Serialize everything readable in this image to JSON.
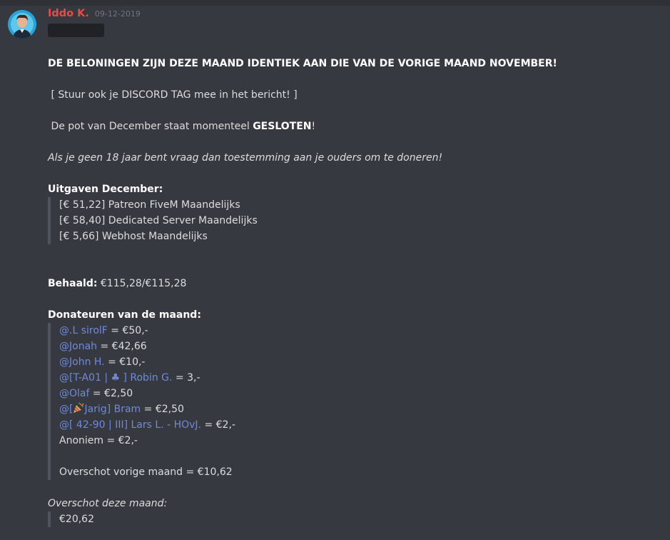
{
  "message": {
    "author": "Iddo K.",
    "timestamp": "09-12-2019",
    "headline": "DE BELONINGEN ZIJN DEZE MAAND IDENTIEK AAN DIE VAN DE VORIGE MAAND NOVEMBER!",
    "discord_tag_note": "[ Stuur ook je DISCORD TAG mee in het bericht! ]",
    "pot_prefix": "De pot van December staat momenteel ",
    "pot_status": "GESLOTEN",
    "pot_suffix": "!",
    "age_note": "Als je geen 18 jaar bent vraag dan toestemming aan je ouders om te doneren!",
    "expenses_title": "Uitgaven December:",
    "expenses": [
      "[€ 51,22] Patreon FiveM Maandelijks",
      "[€ 58,40] Dedicated Server Maandelijks",
      "[€ 5,66] Webhost Maandelijks"
    ],
    "achieved_label": "Behaald:",
    "achieved_value": " €115,28/€115,28",
    "donors_title": "Donateuren van de maand:",
    "donors": [
      {
        "mention": "@.L sirolF",
        "amount": " = €50,-"
      },
      {
        "mention": "@Jonah",
        "amount": " = €42,66"
      },
      {
        "mention": "@John H.",
        "amount": " = €10,-"
      },
      {
        "mention": "@[T-A01 | ♣ ] Robin G.",
        "amount": " = 3,-"
      },
      {
        "mention": "@Olaf",
        "amount": " = €2,50"
      },
      {
        "mention_prefix": "@[",
        "mention": "Jarig] Bram",
        "amount": " = €2,50"
      },
      {
        "mention": "@[ 42-90 | III] Lars L. - HOvJ.",
        "amount": " = €2,-"
      }
    ],
    "anonymous": "Anoniem = €2,-",
    "surplus_previous": "Overschot vorige maand = €10,62",
    "surplus_title": "Overschot deze maand:",
    "surplus_value": "€20,62"
  },
  "colors": {
    "background": "#36393f",
    "author": "#f04747",
    "mention": "#7289da",
    "text": "#dcddde"
  },
  "icons": {
    "avatar": "user-avatar",
    "emoji": "party-popper-icon"
  }
}
